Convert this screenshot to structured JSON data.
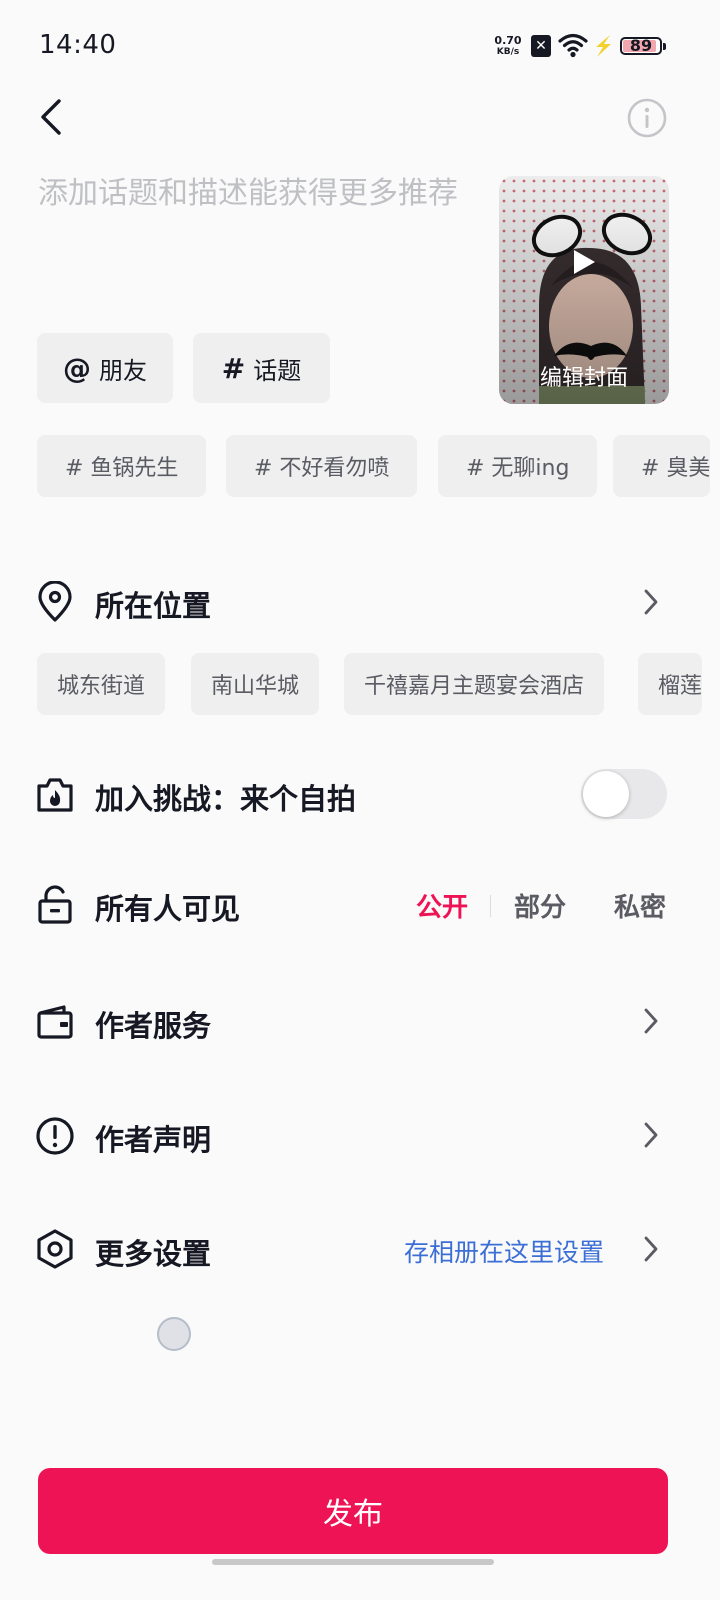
{
  "status_bar": {
    "time": "14:40",
    "net_speed_value": "0.70",
    "net_speed_unit": "KB/s",
    "battery": "89",
    "icons": [
      "sim-x-icon",
      "wifi-icon",
      "charging-bolt-icon",
      "battery-icon"
    ]
  },
  "header": {
    "back_icon": "chevron-left-icon",
    "info_icon": "info-circle-icon"
  },
  "description": {
    "placeholder": "添加话题和描述能获得更多推荐"
  },
  "cover": {
    "label": "编辑封面",
    "play_icon": "play-icon"
  },
  "mention_buttons": [
    {
      "symbol": "@",
      "label": "朋友"
    },
    {
      "symbol": "#",
      "label": "话题"
    }
  ],
  "topic_suggestions": [
    "# 鱼锅先生",
    "# 不好看勿喷",
    "# 无聊ing",
    "# 臭美"
  ],
  "location": {
    "label": "所在位置",
    "icon": "location-pin-icon",
    "suggestions": [
      "城东街道",
      "南山华城",
      "千禧嘉月主题宴会酒店",
      "榴莲"
    ]
  },
  "challenge": {
    "label": "加入挑战：来个自拍",
    "icon": "camera-flame-icon",
    "enabled": false
  },
  "visibility": {
    "label": "所有人可见",
    "icon": "unlock-icon",
    "options": [
      "公开",
      "部分",
      "私密"
    ],
    "selected": "公开",
    "selected_color": "#ee1354"
  },
  "author_service": {
    "label": "作者服务",
    "icon": "wallet-icon"
  },
  "author_statement": {
    "label": "作者声明",
    "icon": "exclamation-circle-icon"
  },
  "more_settings": {
    "label": "更多设置",
    "icon": "hexagon-settings-icon",
    "link": "存相册在这里设置",
    "link_color": "#3c6fd6"
  },
  "publish": {
    "label": "发布",
    "color": "#ee1354"
  }
}
